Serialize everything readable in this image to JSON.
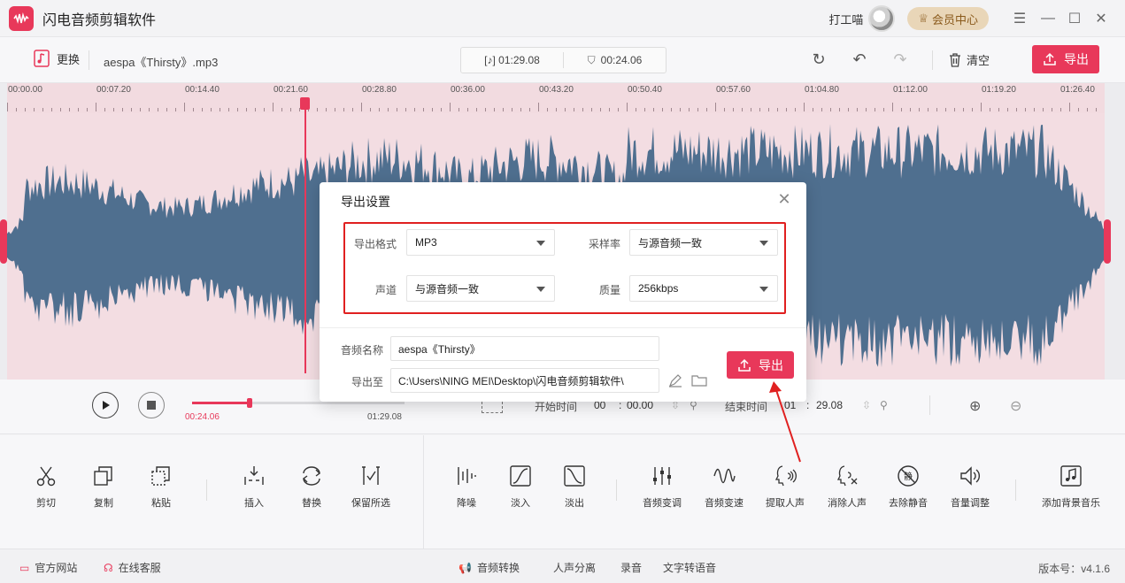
{
  "app": {
    "title": "闪电音频剪辑软件",
    "user_name": "打工喵",
    "vip_label": "会员中心"
  },
  "toolbar": {
    "replace_label": "更换",
    "file_name": "aespa《Thirsty》.mp3",
    "total_time": "[♪] 01:29.08",
    "selection_time": "00:24.06",
    "clear_label": "清空",
    "export_label": "导出"
  },
  "ruler": {
    "labels": [
      "00:00.00",
      "00:07.20",
      "00:14.40",
      "00:21.60",
      "00:28.80",
      "00:36.00",
      "00:43.20",
      "00:50.40",
      "00:57.60",
      "01:04.80",
      "01:12.00",
      "01:19.20",
      "01:26.40"
    ]
  },
  "transport": {
    "current_time": "00:24.06",
    "total_time": "01:29.08",
    "progress": 0.27,
    "start_label": "开始时间",
    "start_min": "00",
    "start_sep": ":",
    "start_sec": "00.00",
    "end_label": "结束时间",
    "end_min": "01",
    "end_sep": ":",
    "end_sec": "29.08"
  },
  "functions": [
    {
      "label": "剪切",
      "icon": "scissors-icon"
    },
    {
      "label": "复制",
      "icon": "copy-icon"
    },
    {
      "label": "粘贴",
      "icon": "paste-icon"
    },
    {
      "label": "插入",
      "icon": "insert-icon"
    },
    {
      "label": "替换",
      "icon": "replace-icon"
    },
    {
      "label": "保留所选",
      "icon": "keep-selection-icon"
    },
    {
      "label": "降噪",
      "icon": "denoise-icon"
    },
    {
      "label": "淡入",
      "icon": "fade-in-icon"
    },
    {
      "label": "淡出",
      "icon": "fade-out-icon"
    },
    {
      "label": "音频变调",
      "icon": "pitch-icon"
    },
    {
      "label": "音频变速",
      "icon": "speed-icon"
    },
    {
      "label": "提取人声",
      "icon": "extract-voice-icon"
    },
    {
      "label": "消除人声",
      "icon": "remove-voice-icon"
    },
    {
      "label": "去除静音",
      "icon": "remove-silence-icon"
    },
    {
      "label": "音量调整",
      "icon": "volume-icon"
    },
    {
      "label": "添加背景音乐",
      "icon": "bg-music-icon"
    }
  ],
  "footer": {
    "website": "官方网站",
    "support": "在线客服",
    "convert": "音频转换",
    "separate": "人声分离",
    "record": "录音",
    "tts": "文字转语音",
    "version": "版本号：v4.1.6"
  },
  "modal": {
    "title": "导出设置",
    "format_label": "导出格式",
    "format_value": "MP3",
    "sample_label": "采样率",
    "sample_value": "与源音频一致",
    "channel_label": "声道",
    "channel_value": "与源音频一致",
    "quality_label": "质量",
    "quality_value": "256kbps",
    "name_label": "音频名称",
    "name_value": "aespa《Thirsty》",
    "path_label": "导出至",
    "path_value": "C:\\Users\\NING MEI\\Desktop\\闪电音频剪辑软件\\",
    "export_label": "导出"
  },
  "colors": {
    "accent": "#e8385a",
    "wave": "#4f6f8f",
    "highlight": "#e02020"
  }
}
